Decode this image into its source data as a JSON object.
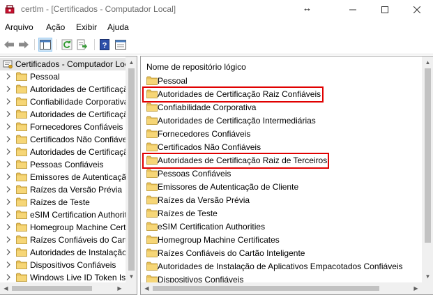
{
  "window": {
    "title": "certlm - [Certificados - Computador Local]",
    "controls": {
      "minimize": "—",
      "maximize": "☐",
      "close": "✕"
    }
  },
  "menu": [
    "Arquivo",
    "Ação",
    "Exibir",
    "Ajuda"
  ],
  "toolbar": [
    "back-arrow-icon",
    "forward-arrow-icon",
    "show-hide-tree-icon",
    "refresh-icon",
    "export-list-icon",
    "help-icon",
    "properties-icon"
  ],
  "tree": {
    "root": "Certificados - Computador Local",
    "items": [
      "Pessoal",
      "Autoridades de Certificação Raiz Confiáveis",
      "Confiabilidade Corporativa",
      "Autoridades de Certificação Intermediárias",
      "Fornecedores Confiáveis",
      "Certificados Não Confiáveis",
      "Autoridades de Certificação Raiz de Terceiros",
      "Pessoas Confiáveis",
      "Emissores de Autenticação de Cliente",
      "Raízes da Versão Prévia",
      "Raízes de Teste",
      "eSIM Certification Authorities",
      "Homegroup Machine Certificates",
      "Raízes Confiáveis do Cartão Inteligente",
      "Autoridades de Instalação de Aplicativos Empacotados Confiáveis",
      "Dispositivos Confiáveis",
      "Windows Live ID Token Issuer"
    ]
  },
  "list": {
    "column_header": "Nome de repositório lógico",
    "items": [
      "Pessoal",
      "Autoridades de Certificação Raiz Confiáveis",
      "Confiabilidade Corporativa",
      "Autoridades de Certificação Intermediárias",
      "Fornecedores Confiáveis",
      "Certificados Não Confiáveis",
      "Autoridades de Certificação Raiz de Terceiros",
      "Pessoas Confiáveis",
      "Emissores de Autenticação de Cliente",
      "Raízes da Versão Prévia",
      "Raízes de Teste",
      "eSIM Certification Authorities",
      "Homegroup Machine Certificates",
      "Raízes Confiáveis do Cartão Inteligente",
      "Autoridades de Instalação de Aplicativos Empacotados Confiáveis",
      "Dispositivos Confiáveis"
    ],
    "highlighted_items": [
      1,
      6
    ]
  },
  "colors": {
    "highlight_border": "#e00000",
    "folder": "#e8c15a",
    "selection": "#e5e5e5"
  }
}
